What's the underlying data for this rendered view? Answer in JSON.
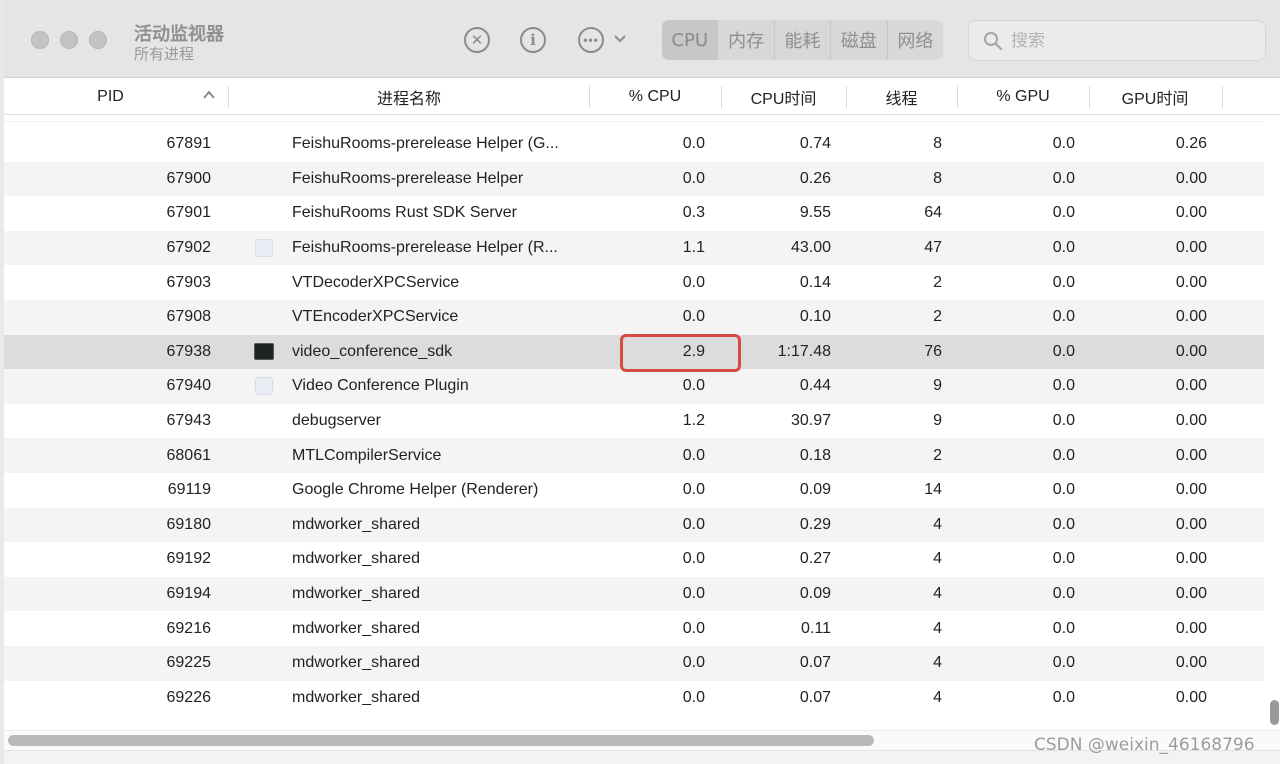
{
  "window": {
    "title": "活动监视器",
    "subtitle": "所有进程"
  },
  "toolbar": {
    "stop_icon": "stop-process-icon",
    "info_icon": "info-icon",
    "more_icon": "ellipsis-icon",
    "tabs": [
      {
        "label": "CPU",
        "active": true
      },
      {
        "label": "内存",
        "active": false
      },
      {
        "label": "能耗",
        "active": false
      },
      {
        "label": "磁盘",
        "active": false
      },
      {
        "label": "网络",
        "active": false
      }
    ],
    "search_placeholder": "搜索"
  },
  "table": {
    "columns": {
      "pid": "PID",
      "name": "进程名称",
      "cpu": "% CPU",
      "cpu_time": "CPU时间",
      "threads": "线程",
      "gpu": "% GPU",
      "gpu_time": "GPU时间"
    },
    "sort": {
      "column": "PID",
      "direction": "ascending"
    },
    "rows": [
      {
        "pid": "67891",
        "icon": "",
        "name": "FeishuRooms-prerelease Helper (G...",
        "cpu": "0.0",
        "cpu_time": "0.74",
        "threads": "8",
        "gpu": "0.0",
        "gpu_time": "0.26"
      },
      {
        "pid": "67900",
        "icon": "",
        "name": "FeishuRooms-prerelease Helper",
        "cpu": "0.0",
        "cpu_time": "0.26",
        "threads": "8",
        "gpu": "0.0",
        "gpu_time": "0.00"
      },
      {
        "pid": "67901",
        "icon": "",
        "name": "FeishuRooms Rust SDK Server",
        "cpu": "0.3",
        "cpu_time": "9.55",
        "threads": "64",
        "gpu": "0.0",
        "gpu_time": "0.00"
      },
      {
        "pid": "67902",
        "icon": "generic-app-icon",
        "name": "FeishuRooms-prerelease Helper (R...",
        "cpu": "1.1",
        "cpu_time": "43.00",
        "threads": "47",
        "gpu": "0.0",
        "gpu_time": "0.00"
      },
      {
        "pid": "67903",
        "icon": "",
        "name": "VTDecoderXPCService",
        "cpu": "0.0",
        "cpu_time": "0.14",
        "threads": "2",
        "gpu": "0.0",
        "gpu_time": "0.00"
      },
      {
        "pid": "67908",
        "icon": "",
        "name": "VTEncoderXPCService",
        "cpu": "0.0",
        "cpu_time": "0.10",
        "threads": "2",
        "gpu": "0.0",
        "gpu_time": "0.00"
      },
      {
        "pid": "67938",
        "icon": "terminal-icon",
        "name": "video_conference_sdk",
        "cpu": "2.9",
        "cpu_time": "1:17.48",
        "threads": "76",
        "gpu": "0.0",
        "gpu_time": "0.00",
        "selected": true
      },
      {
        "pid": "67940",
        "icon": "generic-app-icon",
        "name": "Video Conference Plugin",
        "cpu": "0.0",
        "cpu_time": "0.44",
        "threads": "9",
        "gpu": "0.0",
        "gpu_time": "0.00"
      },
      {
        "pid": "67943",
        "icon": "",
        "name": "debugserver",
        "cpu": "1.2",
        "cpu_time": "30.97",
        "threads": "9",
        "gpu": "0.0",
        "gpu_time": "0.00"
      },
      {
        "pid": "68061",
        "icon": "",
        "name": "MTLCompilerService",
        "cpu": "0.0",
        "cpu_time": "0.18",
        "threads": "2",
        "gpu": "0.0",
        "gpu_time": "0.00"
      },
      {
        "pid": "69119",
        "icon": "",
        "name": "Google Chrome Helper (Renderer)",
        "cpu": "0.0",
        "cpu_time": "0.09",
        "threads": "14",
        "gpu": "0.0",
        "gpu_time": "0.00"
      },
      {
        "pid": "69180",
        "icon": "",
        "name": "mdworker_shared",
        "cpu": "0.0",
        "cpu_time": "0.29",
        "threads": "4",
        "gpu": "0.0",
        "gpu_time": "0.00"
      },
      {
        "pid": "69192",
        "icon": "",
        "name": "mdworker_shared",
        "cpu": "0.0",
        "cpu_time": "0.27",
        "threads": "4",
        "gpu": "0.0",
        "gpu_time": "0.00"
      },
      {
        "pid": "69194",
        "icon": "",
        "name": "mdworker_shared",
        "cpu": "0.0",
        "cpu_time": "0.09",
        "threads": "4",
        "gpu": "0.0",
        "gpu_time": "0.00"
      },
      {
        "pid": "69216",
        "icon": "",
        "name": "mdworker_shared",
        "cpu": "0.0",
        "cpu_time": "0.11",
        "threads": "4",
        "gpu": "0.0",
        "gpu_time": "0.00"
      },
      {
        "pid": "69225",
        "icon": "",
        "name": "mdworker_shared",
        "cpu": "0.0",
        "cpu_time": "0.07",
        "threads": "4",
        "gpu": "0.0",
        "gpu_time": "0.00"
      },
      {
        "pid": "69226",
        "icon": "",
        "name": "mdworker_shared",
        "cpu": "0.0",
        "cpu_time": "0.07",
        "threads": "4",
        "gpu": "0.0",
        "gpu_time": "0.00"
      }
    ]
  },
  "annotation": {
    "highlight_color": "#d94b3f",
    "target": "video_conference_sdk cpu"
  },
  "watermark": "CSDN @weixin_46168796"
}
